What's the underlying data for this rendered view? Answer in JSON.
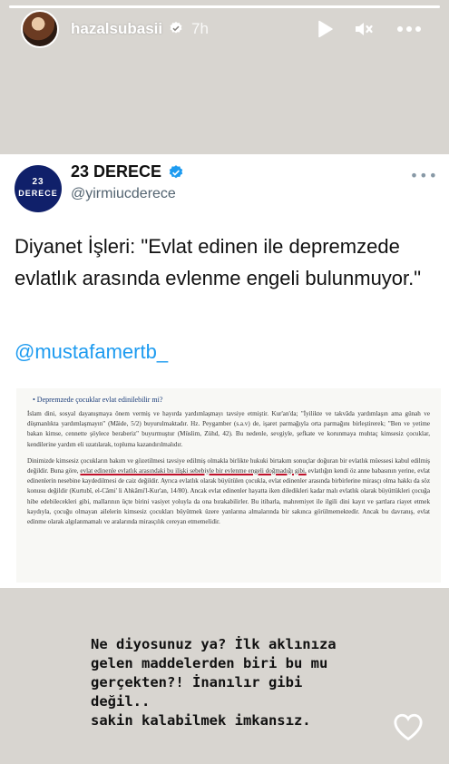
{
  "story": {
    "progress_fraction": 1.0,
    "username": "hazalsubasii",
    "time_ago": "7h",
    "icons": [
      "verified-badge-icon",
      "play-icon",
      "muted-speaker-icon",
      "more-icon"
    ]
  },
  "tweet": {
    "account_name": "23 DERECE",
    "handle": "@yirmiucderece",
    "logo_line1": "23",
    "logo_line2": "DERECE",
    "text": "Diyanet İşleri: \"Evlat edinen ile depremzede evlatlık arasında evlenme engeli bulunmuyor.\"",
    "mention": "@mustafamertb_",
    "document": {
      "heading": "•  Depremzede çocuklar evlat edinilebilir mi?",
      "paragraph1": "İslam dini, sosyal dayanışmaya önem vermiş ve hayırda yardımlaşmayı tavsiye etmiştir. Kur'an'da; \"İyilikte ve takvâda yardımlaşın ama günah ve düşmanlıkta yardımlaşmayın\" (Mâide, 5/2) buyurulmaktadır. Hz. Peygamber (s.a.v) de, işaret parmağıyla orta parmağını birleştirerek; \"Ben ve yetime bakan kimse, cennette şöylece beraberiz\" buyurmuştur (Müslim, Zühd, 42). Bu nedenle, sevgiyle, şefkate ve korunmaya muhtaç kimsesiz çocuklar, kendilerine yardım eli uzatılarak, topluma kazandırılmalıdır.",
      "paragraph2_a": "Dinimizde kimsesiz çocukların bakım ve gözetilmesi tavsiye edilmiş olmakla birlikte hukuki birtakım sonuçlar doğuran bir evlatlık müessesi kabul edilmiş değildir. Buna göre, ",
      "paragraph2_underlined": "evlat edinenle evlatlık arasındaki bu ilişki sebebiyle bir evlenme engeli doğmadığı gibi,",
      "paragraph2_b": " evlatlığın kendi öz anne babasının yerine, evlat edinenlerin nesebine kaydedilmesi de caiz değildir. Ayrıca evlatlık olarak büyütülen çocukla, evlat edinenler arasında birbirlerine mirasçı olma hakkı da söz konusu değildir (Kurtubî, el-Câmi' li Ahkâmi'l-Kur'an, 14/80). Ancak evlat edinenler hayatta iken diledikleri kadar malı evlatlık olarak büyüttükleri çocuğa hibe edebilecekleri gibi, mallarının üçte birini vasiyet yoluyla da ona bırakabilirler. Bu itibarla, mahremiyet ile ilgili dini kayıt ve şartlara riayet etmek kaydıyla, çocuğu olmayan ailelerin kimsesiz çocukları büyütmek üzere yanlarına almalarında bir sakınca görülmemektedir. Ancak bu davranış, evlat edinme olarak algılanmamalı ve aralarında mirasçılık cereyan etmemelidir."
    }
  },
  "caption": {
    "line1": "Ne diyosunuz ya? İlk aklınıza",
    "line2": "gelen maddelerden biri bu mu",
    "line3": "gerçekten?! İnanılır gibi değil..",
    "line4": "sakin kalabilmek imkansız."
  },
  "colors": {
    "background": "#d8d5d0",
    "link_blue": "#1d9bf0",
    "verified_blue": "#1d9bf0",
    "brand_navy": "#10206a",
    "underline_red": "#c0102a"
  }
}
